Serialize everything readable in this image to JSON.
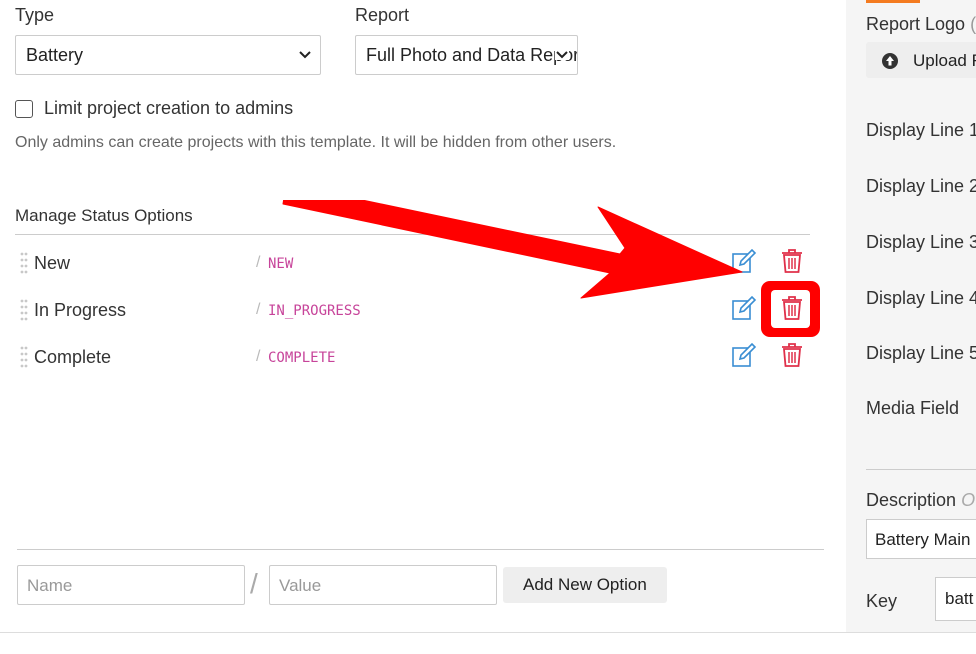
{
  "form": {
    "type_label": "Type",
    "type_value": "Battery",
    "report_label": "Report",
    "report_value": "Full Photo and Data Report",
    "limit_checkbox_label": "Limit project creation to admins",
    "limit_checkbox_checked": false,
    "limit_help": "Only admins can create projects with this template. It will be hidden from other users."
  },
  "status": {
    "heading": "Manage Status Options",
    "separator": "/",
    "options": [
      {
        "name": "New",
        "key": "NEW"
      },
      {
        "name": "In Progress",
        "key": "IN_PROGRESS"
      },
      {
        "name": "Complete",
        "key": "COMPLETE"
      }
    ]
  },
  "new_option": {
    "name_placeholder": "Name",
    "separator": "/",
    "value_placeholder": "Value",
    "add_label": "Add New Option"
  },
  "right_panel": {
    "report_logo_label": "Report Logo",
    "report_logo_suffix": "(",
    "upload_label": "Upload F",
    "display_lines": [
      "Display Line 1",
      "Display Line 2",
      "Display Line 3",
      "Display Line 4",
      "Display Line 5"
    ],
    "media_field_label": "Media Field",
    "description_label": "Description",
    "description_suffix": "O",
    "description_value": "Battery Main",
    "key_label": "Key",
    "key_value": "batt"
  },
  "icons": {
    "edit": "edit-icon",
    "delete": "trash-icon",
    "drag": "drag-handle-icon",
    "upload": "upload-icon",
    "annotation_arrow": "red-arrow",
    "annotation_highlight": "red-highlight-box"
  },
  "colors": {
    "edit_icon": "#3a8ed3",
    "delete_icon": "#e0304a",
    "annotation": "#ff0000",
    "key_text": "#c7449a",
    "orange_accent": "#f47b20"
  }
}
